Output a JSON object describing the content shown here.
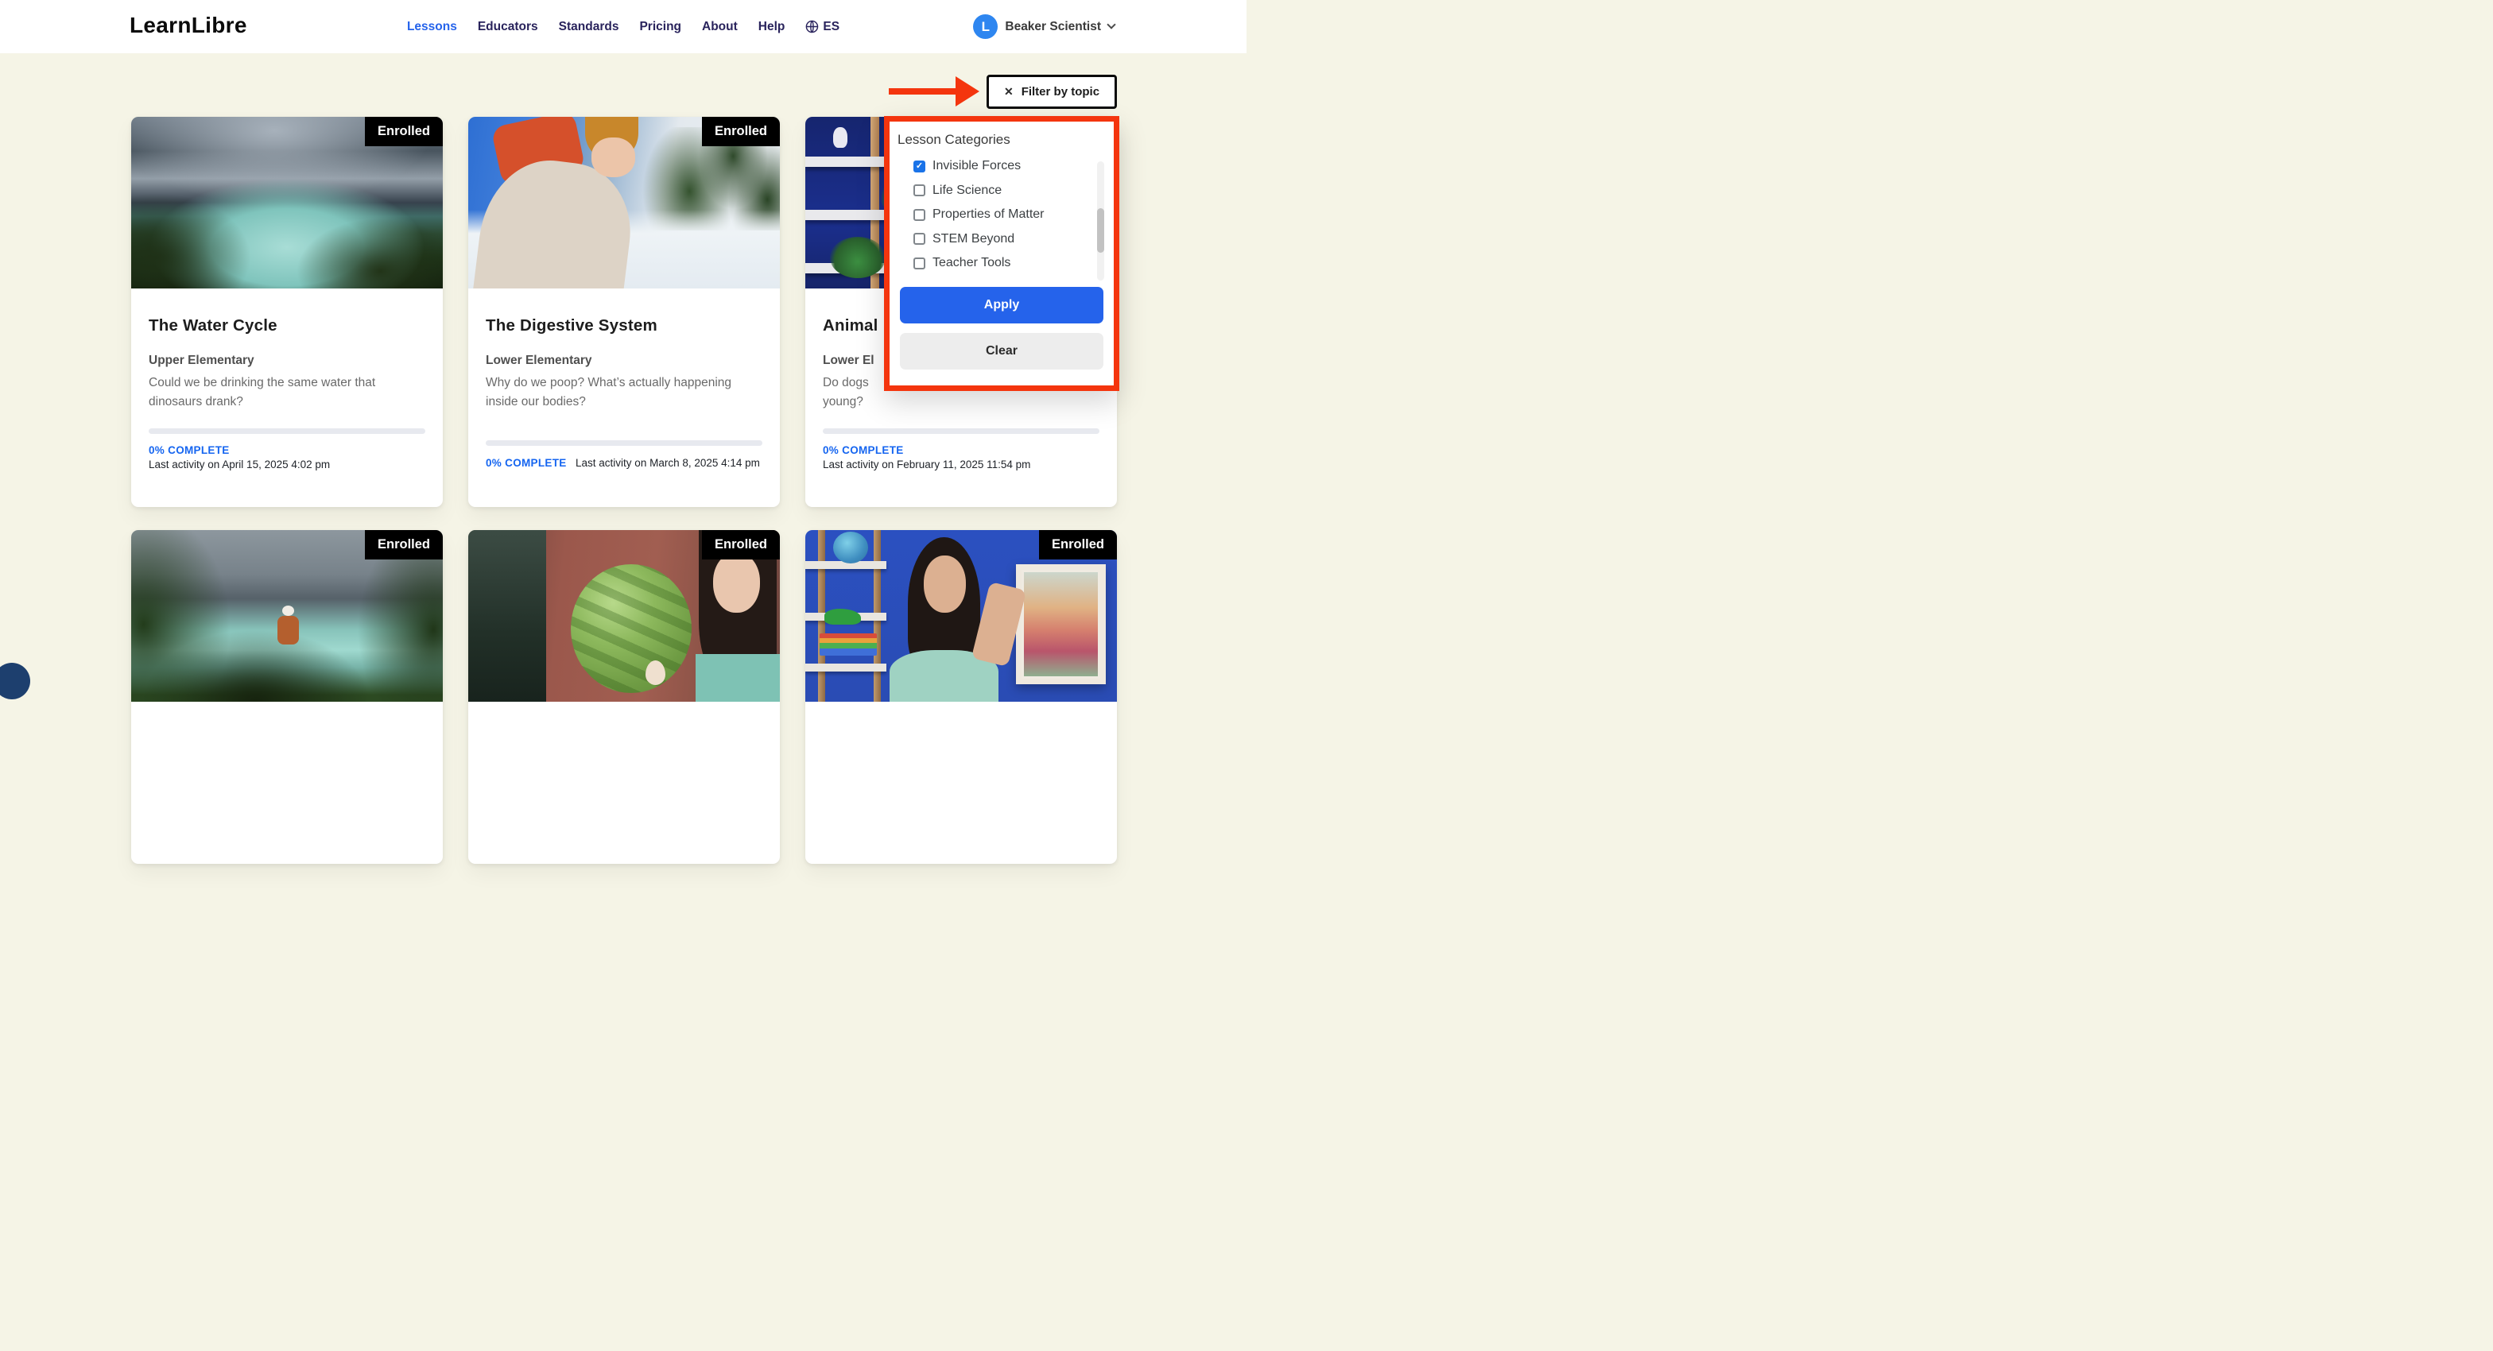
{
  "header": {
    "logo": "LearnLibre",
    "nav": [
      {
        "label": "Lessons",
        "active": true
      },
      {
        "label": "Educators",
        "active": false
      },
      {
        "label": "Standards",
        "active": false
      },
      {
        "label": "Pricing",
        "active": false
      },
      {
        "label": "About",
        "active": false
      },
      {
        "label": "Help",
        "active": false
      }
    ],
    "language_label": "ES",
    "user": {
      "initial": "L",
      "name": "Beaker Scientist"
    }
  },
  "filter": {
    "close_glyph": "✕",
    "button_label": "Filter by topic",
    "panel_title": "Lesson Categories",
    "check_glyph": "✓",
    "categories": [
      {
        "label": "Invisible Forces",
        "checked": true
      },
      {
        "label": "Life Science",
        "checked": false
      },
      {
        "label": "Properties of Matter",
        "checked": false
      },
      {
        "label": "STEM Beyond",
        "checked": false
      },
      {
        "label": "Teacher Tools",
        "checked": false
      }
    ],
    "apply_label": "Apply",
    "clear_label": "Clear",
    "annotation_color": "#f4350e"
  },
  "cards_row1": [
    {
      "badge": "Enrolled",
      "title": "The Water Cycle",
      "grade": "Upper Elementary",
      "description": "Could we be drinking the same water that dinosaurs drank?",
      "progress_label": "0% COMPLETE",
      "progress_percent": 0,
      "last_activity": "Last activity on April 15, 2025 4:02 pm",
      "thumbnail_alt": "stormy clouds over a turquoise lake between forested hills"
    },
    {
      "badge": "Enrolled",
      "title": "The Digestive System",
      "grade": "Lower Elementary",
      "description": "Why do we poop? What’s actually happening inside our bodies?",
      "progress_label": "0% COMPLETE",
      "progress_percent": 0,
      "last_activity": "Last activity on March 8, 2025 4:14 pm",
      "thumbnail_alt": "hiker selfie with orange backpack on a snowy mountain trail"
    },
    {
      "badge": "Enrolled",
      "title": "Animal",
      "grade": "Lower El",
      "description_line1": "Do dogs",
      "description_line2": "young?",
      "progress_label": "0% COMPLETE",
      "progress_percent": 0,
      "last_activity": "Last activity on February 11, 2025 11:54 pm",
      "thumbnail_alt": "wooden shelf with plants and toys against a dark blue wall"
    }
  ],
  "cards_row2": [
    {
      "badge": "Enrolled",
      "thumbnail_alt": "woman in white beanie standing before a mountain lake"
    },
    {
      "badge": "Enrolled",
      "thumbnail_alt": "woman holding a watermelon and an egg outside a brick building"
    },
    {
      "badge": "Enrolled",
      "thumbnail_alt": "woman with braids holding a magnet and paperclip by a blue wall"
    }
  ]
}
